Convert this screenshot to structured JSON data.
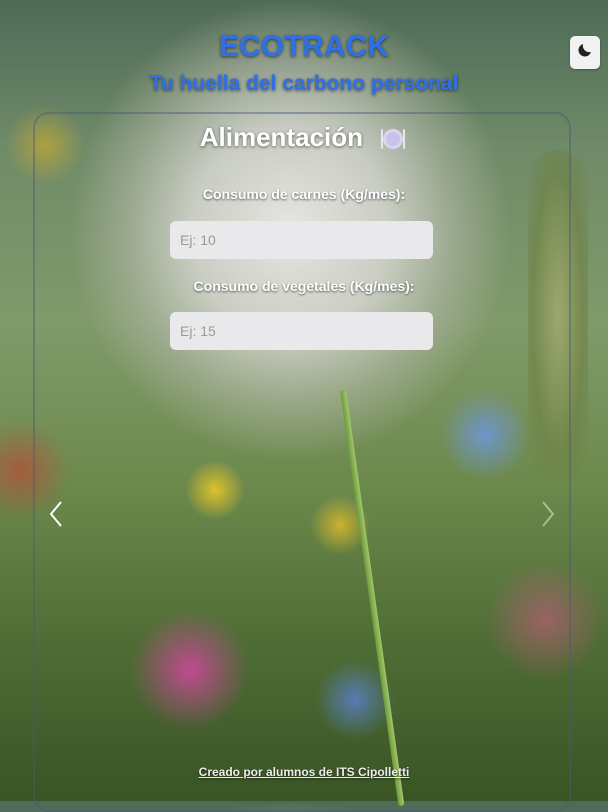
{
  "header": {
    "title": "ECOTRACK",
    "subtitle": "Tu huella del carbono personal"
  },
  "theme_toggle": {
    "icon": "moon-icon"
  },
  "section": {
    "title": "Alimentación",
    "icon": "plate-icon"
  },
  "fields": {
    "meat": {
      "label": "Consumo de carnes (Kg/mes):",
      "placeholder": "Ej: 10",
      "value": ""
    },
    "vegetables": {
      "label": "Consumo de vegetales (Kg/mes):",
      "placeholder": "Ej: 15",
      "value": ""
    }
  },
  "carousel": {
    "prev_icon": "chevron-left-icon",
    "next_icon": "chevron-right-icon"
  },
  "footer": {
    "credit": "Creado por alumnos de ITS Cipolletti"
  },
  "colors": {
    "accent": "#2f6fe8",
    "input_bg": "#e9e9ec"
  }
}
